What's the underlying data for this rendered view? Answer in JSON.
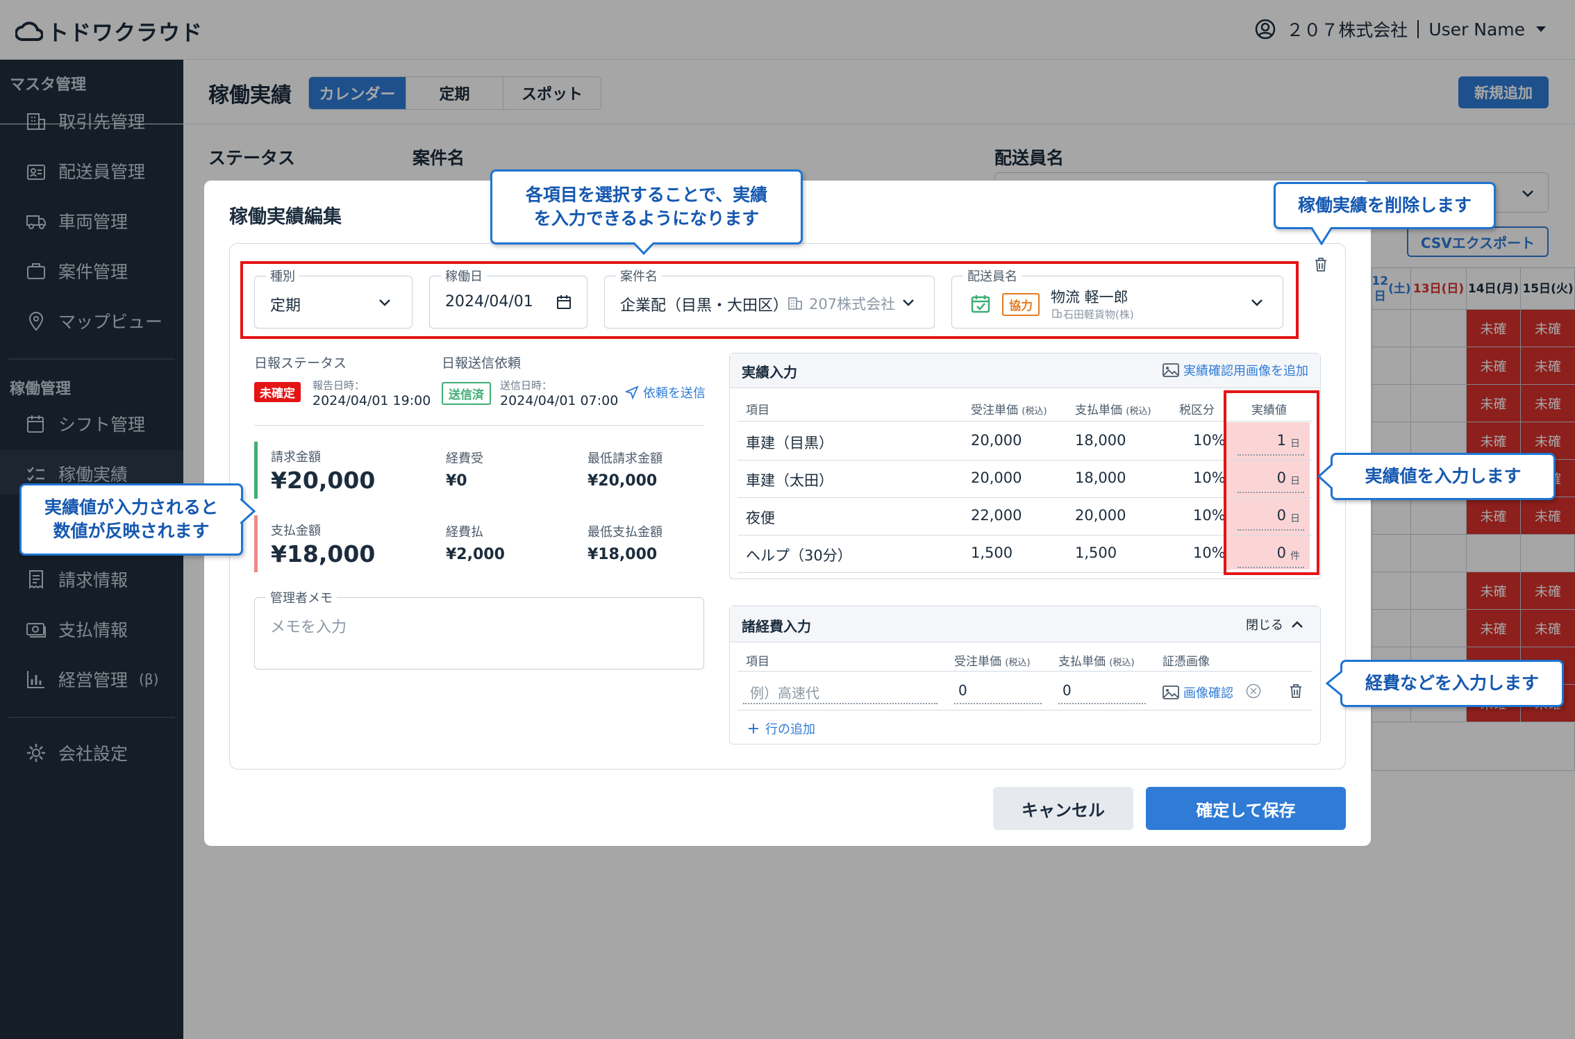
{
  "app": {
    "logo_text": "トドワクラウド",
    "company": "２０７株式会社",
    "user": "User Name"
  },
  "sidebar": {
    "section_master": "マスタ管理",
    "master_items": [
      "取引先管理",
      "配送員管理",
      "車両管理",
      "案件管理",
      "マップビュー"
    ],
    "section_ops": "稼働管理",
    "ops_items": [
      "シフト管理",
      "稼働実績"
    ],
    "other_items": [
      "請求情報",
      "支払情報",
      "経営管理"
    ],
    "beta": "(β)",
    "settings": "会社設定"
  },
  "page": {
    "title": "稼働実績",
    "tabs": [
      "カレンダー",
      "定期",
      "スポット"
    ],
    "active_tab": "カレンダー",
    "new_button": "新規追加",
    "filter_labels": [
      "ステータス",
      "案件名",
      "配送員名"
    ],
    "csv_button": "CSVエクスポート"
  },
  "calendar": {
    "headers": [
      {
        "d": "12日",
        "w": "(土)",
        "color": "#2f7bd6"
      },
      {
        "d": "13日",
        "w": "(日)",
        "color": "#d9302c"
      },
      {
        "d": "14日",
        "w": "(月)",
        "color": "#1b2c3d"
      },
      {
        "d": "15日",
        "w": "(火)",
        "color": "#1b2c3d"
      }
    ],
    "cell_text": "未確"
  },
  "modal": {
    "title": "稼働実績編集",
    "fields": {
      "type": {
        "label": "種別",
        "value": "定期"
      },
      "date": {
        "label": "稼働日",
        "value": "2024/04/01"
      },
      "project": {
        "label": "案件名",
        "value": "企業配（目黒・大田区）",
        "client": "207株式会社"
      },
      "driver": {
        "label": "配送員名",
        "badge": "協力",
        "name": "物流 軽一郎",
        "company": "石田軽貨物(株)"
      }
    },
    "status": {
      "daily_label": "日報ステータス",
      "daily_badge": "未確定",
      "report_time_label": "報告日時：",
      "report_time": "2024/04/01 19:00",
      "send_label": "日報送信依頼",
      "send_badge": "送信済",
      "send_time_label": "送信日時：",
      "send_time": "2024/04/01 07:00",
      "send_link": "依頼を送信"
    },
    "amounts": {
      "bill_label": "請求金額",
      "bill": "¥20,000",
      "exp_recv_label": "経費受",
      "exp_recv": "¥0",
      "min_bill_label": "最低請求金額",
      "min_bill": "¥20,000",
      "pay_label": "支払金額",
      "pay": "¥18,000",
      "exp_pay_label": "経費払",
      "exp_pay": "¥2,000",
      "min_pay_label": "最低支払金額",
      "min_pay": "¥18,000"
    },
    "memo": {
      "label": "管理者メモ",
      "placeholder": "メモを入力"
    },
    "results": {
      "title": "実績入力",
      "add_image": "実績確認用画像を追加",
      "headers": {
        "item": "項目",
        "order": "受注単価",
        "pay": "支払単価",
        "tax_note": "(税込)",
        "tax": "税区分",
        "value": "実績値"
      },
      "rows": [
        {
          "item": "車建（目黒）",
          "order": "20,000",
          "pay": "18,000",
          "tax": "10%",
          "value": "1",
          "unit": "日"
        },
        {
          "item": "車建（太田）",
          "order": "20,000",
          "pay": "18,000",
          "tax": "10%",
          "value": "0",
          "unit": "日"
        },
        {
          "item": "夜便",
          "order": "22,000",
          "pay": "20,000",
          "tax": "10%",
          "value": "0",
          "unit": "日"
        },
        {
          "item": "ヘルプ（30分）",
          "order": "1,500",
          "pay": "1,500",
          "tax": "10%",
          "value": "0",
          "unit": "件"
        }
      ]
    },
    "expenses": {
      "title": "諸経費入力",
      "close": "閉じる",
      "headers": {
        "item": "項目",
        "order": "受注単価",
        "pay": "支払単価",
        "tax_note": "(税込)",
        "image": "証憑画像"
      },
      "row": {
        "placeholder": "例）高速代",
        "order": "0",
        "pay": "0",
        "image_link": "画像確認"
      },
      "add_row": "行の追加"
    },
    "cancel": "キャンセル",
    "save": "確定して保存"
  },
  "callouts": {
    "select": "各項目を選択することで、実績\nを入力できるようになります",
    "delete": "稼働実績を削除します",
    "reflect": "実績値が入力されると\n数値が反映されます",
    "input_value": "実績値を入力します",
    "expense": "経費などを入力します"
  },
  "colors": {
    "accent": "#2f7bd6",
    "danger": "#e41414",
    "green": "#3fae74",
    "orange": "#e57a1e"
  }
}
